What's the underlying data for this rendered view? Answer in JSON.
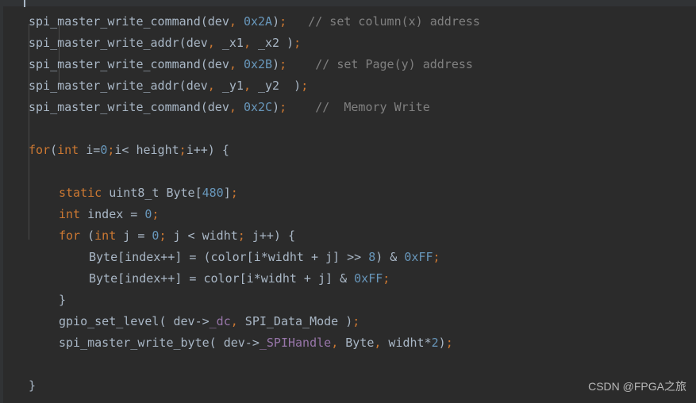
{
  "editor": {
    "theme": "darcula",
    "background_color": "#2b2b2b",
    "band_color": "#313335",
    "default_text_color": "#a9b7c6",
    "keyword_color": "#cc7832",
    "number_color": "#6897bb",
    "comment_color": "#808080",
    "member_color": "#9876aa",
    "indent_guide_color": "#4b4b4b",
    "language": "c"
  },
  "watermark": {
    "text": "CSDN @FPGA之旅"
  },
  "code": {
    "lines": [
      {
        "indent": 36,
        "tokens": [
          {
            "t": "spi_master_write_command",
            "c": "fn"
          },
          {
            "t": "(",
            "c": "pun"
          },
          {
            "t": "dev",
            "c": "fn"
          },
          {
            "t": ",",
            "c": "semi"
          },
          {
            "t": " ",
            "c": "pun"
          },
          {
            "t": "0x2A",
            "c": "num"
          },
          {
            "t": ")",
            "c": "pun"
          },
          {
            "t": ";",
            "c": "semi"
          },
          {
            "t": "   ",
            "c": "pun"
          },
          {
            "t": "// set column(x) address",
            "c": "cmt"
          }
        ]
      },
      {
        "indent": 36,
        "tokens": [
          {
            "t": "spi_master_write_addr",
            "c": "fn"
          },
          {
            "t": "(",
            "c": "pun"
          },
          {
            "t": "dev",
            "c": "fn"
          },
          {
            "t": ",",
            "c": "semi"
          },
          {
            "t": " _x1",
            "c": "fn"
          },
          {
            "t": ",",
            "c": "semi"
          },
          {
            "t": " _x2 )",
            "c": "pun"
          },
          {
            "t": ";",
            "c": "semi"
          }
        ]
      },
      {
        "indent": 36,
        "tokens": [
          {
            "t": "spi_master_write_command",
            "c": "fn"
          },
          {
            "t": "(",
            "c": "pun"
          },
          {
            "t": "dev",
            "c": "fn"
          },
          {
            "t": ",",
            "c": "semi"
          },
          {
            "t": " ",
            "c": "pun"
          },
          {
            "t": "0x2B",
            "c": "num"
          },
          {
            "t": ")",
            "c": "pun"
          },
          {
            "t": ";",
            "c": "semi"
          },
          {
            "t": "    ",
            "c": "pun"
          },
          {
            "t": "// set Page(y) address",
            "c": "cmt"
          }
        ]
      },
      {
        "indent": 36,
        "tokens": [
          {
            "t": "spi_master_write_addr",
            "c": "fn"
          },
          {
            "t": "(",
            "c": "pun"
          },
          {
            "t": "dev",
            "c": "fn"
          },
          {
            "t": ",",
            "c": "semi"
          },
          {
            "t": " _y1",
            "c": "fn"
          },
          {
            "t": ",",
            "c": "semi"
          },
          {
            "t": " _y2  )",
            "c": "pun"
          },
          {
            "t": ";",
            "c": "semi"
          }
        ]
      },
      {
        "indent": 36,
        "tokens": [
          {
            "t": "spi_master_write_command",
            "c": "fn"
          },
          {
            "t": "(",
            "c": "pun"
          },
          {
            "t": "dev",
            "c": "fn"
          },
          {
            "t": ",",
            "c": "semi"
          },
          {
            "t": " ",
            "c": "pun"
          },
          {
            "t": "0x2C",
            "c": "num"
          },
          {
            "t": ")",
            "c": "pun"
          },
          {
            "t": ";",
            "c": "semi"
          },
          {
            "t": "    ",
            "c": "pun"
          },
          {
            "t": "//  Memory Write",
            "c": "cmt"
          }
        ]
      },
      {
        "indent": 36,
        "tokens": []
      },
      {
        "indent": 36,
        "tokens": [
          {
            "t": "for",
            "c": "kw"
          },
          {
            "t": "(",
            "c": "pun"
          },
          {
            "t": "int",
            "c": "kw"
          },
          {
            "t": " i=",
            "c": "pun"
          },
          {
            "t": "0",
            "c": "num"
          },
          {
            "t": ";",
            "c": "semi"
          },
          {
            "t": "i< height",
            "c": "pun"
          },
          {
            "t": ";",
            "c": "semi"
          },
          {
            "t": "i++) {",
            "c": "pun"
          }
        ]
      },
      {
        "indent": 36,
        "tokens": []
      },
      {
        "indent": 74,
        "tokens": [
          {
            "t": "static",
            "c": "kw"
          },
          {
            "t": " uint8_t Byte[",
            "c": "pun"
          },
          {
            "t": "480",
            "c": "num"
          },
          {
            "t": "]",
            "c": "pun"
          },
          {
            "t": ";",
            "c": "semi"
          }
        ]
      },
      {
        "indent": 74,
        "tokens": [
          {
            "t": "int",
            "c": "kw"
          },
          {
            "t": " index = ",
            "c": "pun"
          },
          {
            "t": "0",
            "c": "num"
          },
          {
            "t": ";",
            "c": "semi"
          }
        ]
      },
      {
        "indent": 74,
        "tokens": [
          {
            "t": "for",
            "c": "kw"
          },
          {
            "t": " (",
            "c": "pun"
          },
          {
            "t": "int",
            "c": "kw"
          },
          {
            "t": " j = ",
            "c": "pun"
          },
          {
            "t": "0",
            "c": "num"
          },
          {
            "t": ";",
            "c": "semi"
          },
          {
            "t": " j < widht",
            "c": "pun"
          },
          {
            "t": ";",
            "c": "semi"
          },
          {
            "t": " j++) {",
            "c": "pun"
          }
        ]
      },
      {
        "indent": 112,
        "tokens": [
          {
            "t": "Byte[index++] = (color[i*widht + j] >> ",
            "c": "pun"
          },
          {
            "t": "8",
            "c": "num"
          },
          {
            "t": ") & ",
            "c": "pun"
          },
          {
            "t": "0xFF",
            "c": "num"
          },
          {
            "t": ";",
            "c": "semi"
          }
        ]
      },
      {
        "indent": 112,
        "tokens": [
          {
            "t": "Byte[index++] = color[i*widht + j] & ",
            "c": "pun"
          },
          {
            "t": "0xFF",
            "c": "num"
          },
          {
            "t": ";",
            "c": "semi"
          }
        ]
      },
      {
        "indent": 74,
        "tokens": [
          {
            "t": "}",
            "c": "pun"
          }
        ]
      },
      {
        "indent": 74,
        "tokens": [
          {
            "t": "gpio_set_level",
            "c": "fn"
          },
          {
            "t": "( dev->",
            "c": "pun"
          },
          {
            "t": "_dc",
            "c": "mem"
          },
          {
            "t": ",",
            "c": "semi"
          },
          {
            "t": " SPI_Data_Mode )",
            "c": "pun"
          },
          {
            "t": ";",
            "c": "semi"
          }
        ]
      },
      {
        "indent": 74,
        "tokens": [
          {
            "t": "spi_master_write_byte",
            "c": "fn"
          },
          {
            "t": "( dev->",
            "c": "pun"
          },
          {
            "t": "_SPIHandle",
            "c": "mem"
          },
          {
            "t": ",",
            "c": "semi"
          },
          {
            "t": " Byte",
            "c": "pun"
          },
          {
            "t": ",",
            "c": "semi"
          },
          {
            "t": " widht*",
            "c": "pun"
          },
          {
            "t": "2",
            "c": "num"
          },
          {
            "t": ")",
            "c": "pun"
          },
          {
            "t": ";",
            "c": "semi"
          }
        ]
      },
      {
        "indent": 36,
        "tokens": []
      },
      {
        "indent": 36,
        "tokens": [
          {
            "t": "}",
            "c": "pun"
          }
        ]
      }
    ]
  }
}
